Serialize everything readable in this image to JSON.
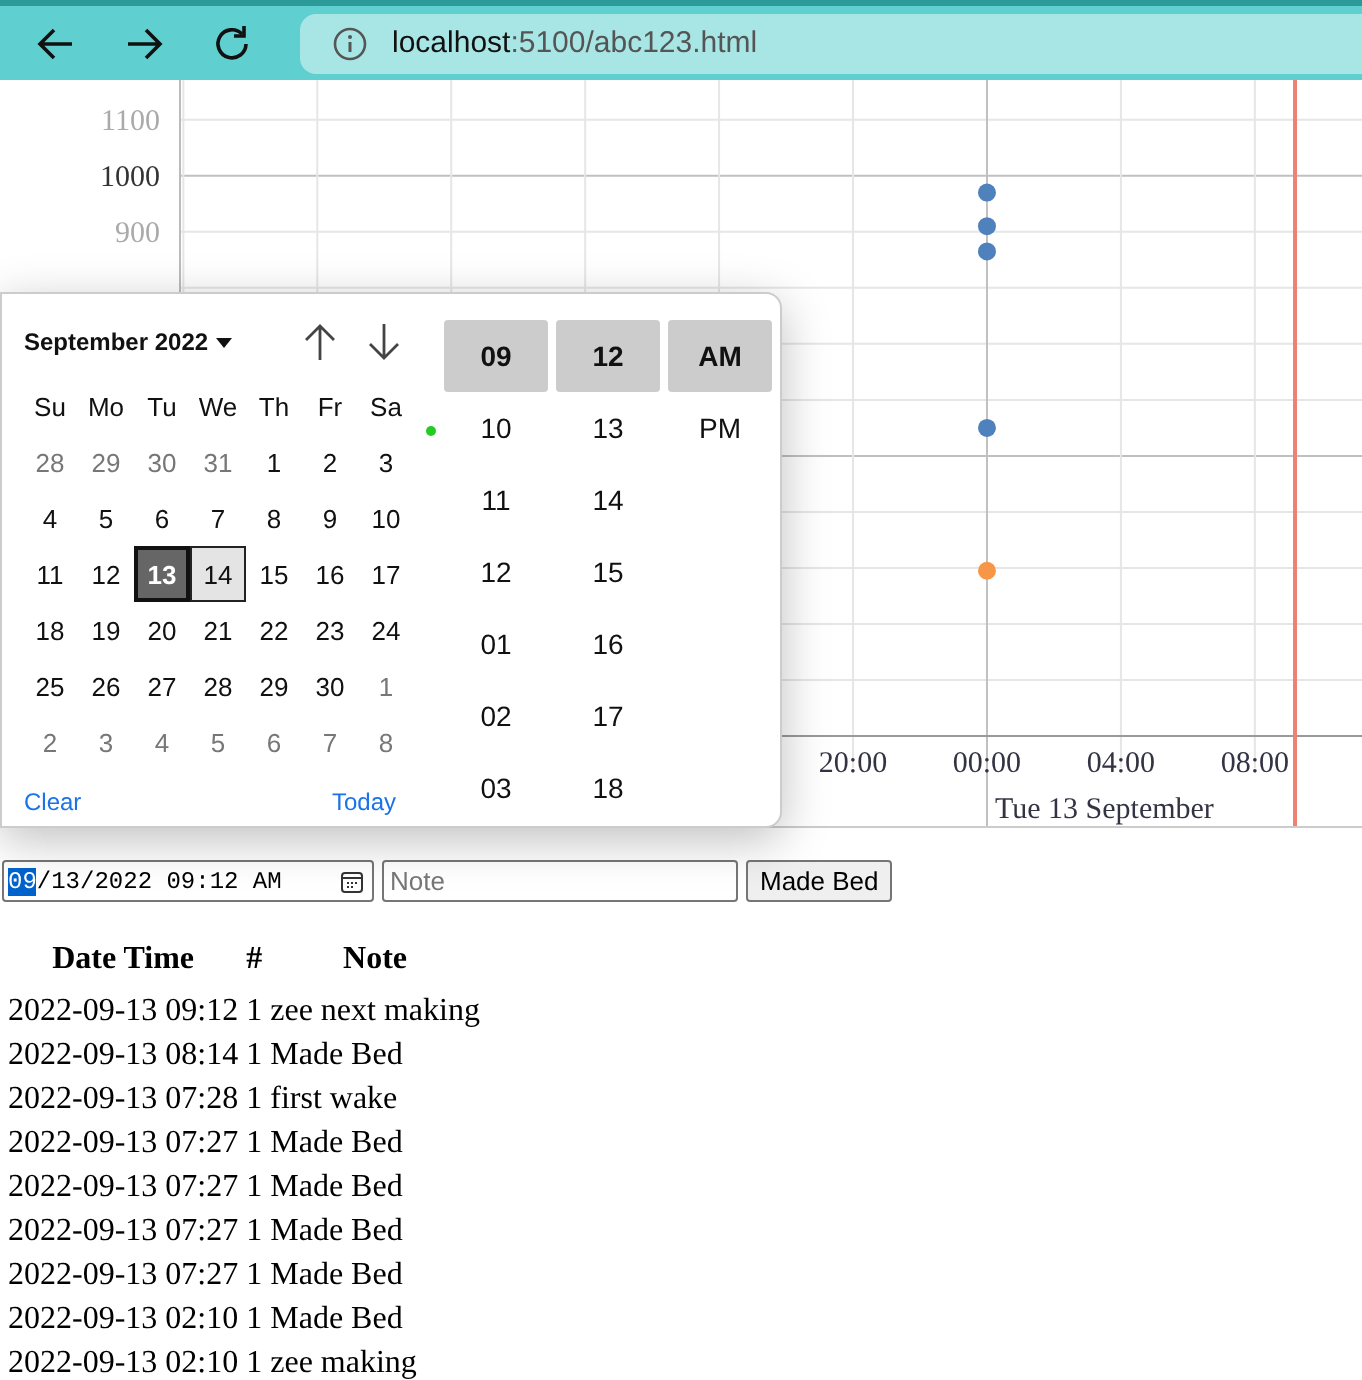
{
  "browser": {
    "address": {
      "host": "localhost",
      "path": ":5100/abc123.html"
    }
  },
  "chart": {
    "chart_data": {
      "type": "scatter",
      "xlabel": "Tue 13 September",
      "x": [
        "2022-09-13T00:00",
        "2022-09-13T00:00",
        "2022-09-13T00:00",
        "2022-09-13T00:00"
      ],
      "series": [
        {
          "color": "#4f81bd",
          "values": [
            970,
            910,
            865,
            550
          ]
        },
        {
          "color": "#f79646",
          "values": [
            295,
            null,
            null,
            null
          ]
        }
      ],
      "xlim": [
        "2022-09-11T23:54",
        "2022-09-13T11:12"
      ],
      "ylim": [
        0,
        1171
      ],
      "xticks": [
        {
          "value": "2022-09-12T20:00",
          "label": "20:00"
        },
        {
          "value": "2022-09-13T00:00",
          "label": "00:00"
        },
        {
          "value": "2022-09-13T04:00",
          "label": "04:00"
        },
        {
          "value": "2022-09-13T08:00",
          "label": "08:00"
        }
      ],
      "yticks": [
        900,
        1000,
        1100
      ],
      "grid": true,
      "ref_lines": [
        {
          "axis": "x",
          "value": "2022-09-13T09:12"
        }
      ]
    }
  },
  "date_picker": {
    "month_label": "September 2022",
    "weekdays": [
      "Su",
      "Mo",
      "Tu",
      "We",
      "Th",
      "Fr",
      "Sa"
    ],
    "weeks": [
      [
        {
          "day": "28",
          "muted": true,
          "selected": false,
          "highlighted": false
        },
        {
          "day": "29",
          "muted": true,
          "selected": false,
          "highlighted": false
        },
        {
          "day": "30",
          "muted": true,
          "selected": false,
          "highlighted": false
        },
        {
          "day": "31",
          "muted": true,
          "selected": false,
          "highlighted": false
        },
        {
          "day": "1",
          "muted": false,
          "selected": false,
          "highlighted": false
        },
        {
          "day": "2",
          "muted": false,
          "selected": false,
          "highlighted": false
        },
        {
          "day": "3",
          "muted": false,
          "selected": false,
          "highlighted": false
        }
      ],
      [
        {
          "day": "4",
          "muted": false,
          "selected": false,
          "highlighted": false
        },
        {
          "day": "5",
          "muted": false,
          "selected": false,
          "highlighted": false
        },
        {
          "day": "6",
          "muted": false,
          "selected": false,
          "highlighted": false
        },
        {
          "day": "7",
          "muted": false,
          "selected": false,
          "highlighted": false
        },
        {
          "day": "8",
          "muted": false,
          "selected": false,
          "highlighted": false
        },
        {
          "day": "9",
          "muted": false,
          "selected": false,
          "highlighted": false
        },
        {
          "day": "10",
          "muted": false,
          "selected": false,
          "highlighted": false
        }
      ],
      [
        {
          "day": "11",
          "muted": false,
          "selected": false,
          "highlighted": false
        },
        {
          "day": "12",
          "muted": false,
          "selected": false,
          "highlighted": false
        },
        {
          "day": "13",
          "muted": false,
          "selected": true,
          "highlighted": false
        },
        {
          "day": "14",
          "muted": false,
          "selected": false,
          "highlighted": true
        },
        {
          "day": "15",
          "muted": false,
          "selected": false,
          "highlighted": false
        },
        {
          "day": "16",
          "muted": false,
          "selected": false,
          "highlighted": false
        },
        {
          "day": "17",
          "muted": false,
          "selected": false,
          "highlighted": false
        }
      ],
      [
        {
          "day": "18",
          "muted": false,
          "selected": false,
          "highlighted": false
        },
        {
          "day": "19",
          "muted": false,
          "selected": false,
          "highlighted": false
        },
        {
          "day": "20",
          "muted": false,
          "selected": false,
          "highlighted": false
        },
        {
          "day": "21",
          "muted": false,
          "selected": false,
          "highlighted": false
        },
        {
          "day": "22",
          "muted": false,
          "selected": false,
          "highlighted": false
        },
        {
          "day": "23",
          "muted": false,
          "selected": false,
          "highlighted": false
        },
        {
          "day": "24",
          "muted": false,
          "selected": false,
          "highlighted": false
        }
      ],
      [
        {
          "day": "25",
          "muted": false,
          "selected": false,
          "highlighted": false
        },
        {
          "day": "26",
          "muted": false,
          "selected": false,
          "highlighted": false
        },
        {
          "day": "27",
          "muted": false,
          "selected": false,
          "highlighted": false
        },
        {
          "day": "28",
          "muted": false,
          "selected": false,
          "highlighted": false
        },
        {
          "day": "29",
          "muted": false,
          "selected": false,
          "highlighted": false
        },
        {
          "day": "30",
          "muted": false,
          "selected": false,
          "highlighted": false
        },
        {
          "day": "1",
          "muted": true,
          "selected": false,
          "highlighted": false
        }
      ],
      [
        {
          "day": "2",
          "muted": true,
          "selected": false,
          "highlighted": false
        },
        {
          "day": "3",
          "muted": true,
          "selected": false,
          "highlighted": false
        },
        {
          "day": "4",
          "muted": true,
          "selected": false,
          "highlighted": false
        },
        {
          "day": "5",
          "muted": true,
          "selected": false,
          "highlighted": false
        },
        {
          "day": "6",
          "muted": true,
          "selected": false,
          "highlighted": false
        },
        {
          "day": "7",
          "muted": true,
          "selected": false,
          "highlighted": false
        },
        {
          "day": "8",
          "muted": true,
          "selected": false,
          "highlighted": false
        }
      ]
    ],
    "clear": "Clear",
    "today": "Today",
    "hours": [
      {
        "label": "09",
        "selected": true
      },
      {
        "label": "10",
        "selected": false
      },
      {
        "label": "11",
        "selected": false
      },
      {
        "label": "12",
        "selected": false
      },
      {
        "label": "01",
        "selected": false
      },
      {
        "label": "02",
        "selected": false
      },
      {
        "label": "03",
        "selected": false
      }
    ],
    "minutes": [
      {
        "label": "12",
        "selected": true
      },
      {
        "label": "13",
        "selected": false
      },
      {
        "label": "14",
        "selected": false
      },
      {
        "label": "15",
        "selected": false
      },
      {
        "label": "16",
        "selected": false
      },
      {
        "label": "17",
        "selected": false
      },
      {
        "label": "18",
        "selected": false
      }
    ],
    "periods": [
      {
        "label": "AM",
        "selected": true
      },
      {
        "label": "PM",
        "selected": false
      }
    ]
  },
  "form": {
    "datetime": {
      "parts": [
        {
          "text": "09",
          "selected": true
        },
        {
          "text": "/13/2022 09:12 AM",
          "selected": false
        }
      ]
    },
    "note": {
      "placeholder": "Note"
    },
    "button": "Made Bed"
  },
  "table": {
    "columns": [
      "Date Time",
      "#",
      "Note"
    ],
    "rows": [
      [
        "2022-09-13 09:12",
        "1",
        "zee next making"
      ],
      [
        "2022-09-13 08:14",
        "1",
        "Made Bed"
      ],
      [
        "2022-09-13 07:28",
        "1",
        "first wake"
      ],
      [
        "2022-09-13 07:27",
        "1",
        "Made Bed"
      ],
      [
        "2022-09-13 07:27",
        "1",
        "Made Bed"
      ],
      [
        "2022-09-13 07:27",
        "1",
        "Made Bed"
      ],
      [
        "2022-09-13 07:27",
        "1",
        "Made Bed"
      ],
      [
        "2022-09-13 02:10",
        "1",
        "Made Bed"
      ],
      [
        "2022-09-13 02:10",
        "1",
        "zee making"
      ]
    ]
  }
}
